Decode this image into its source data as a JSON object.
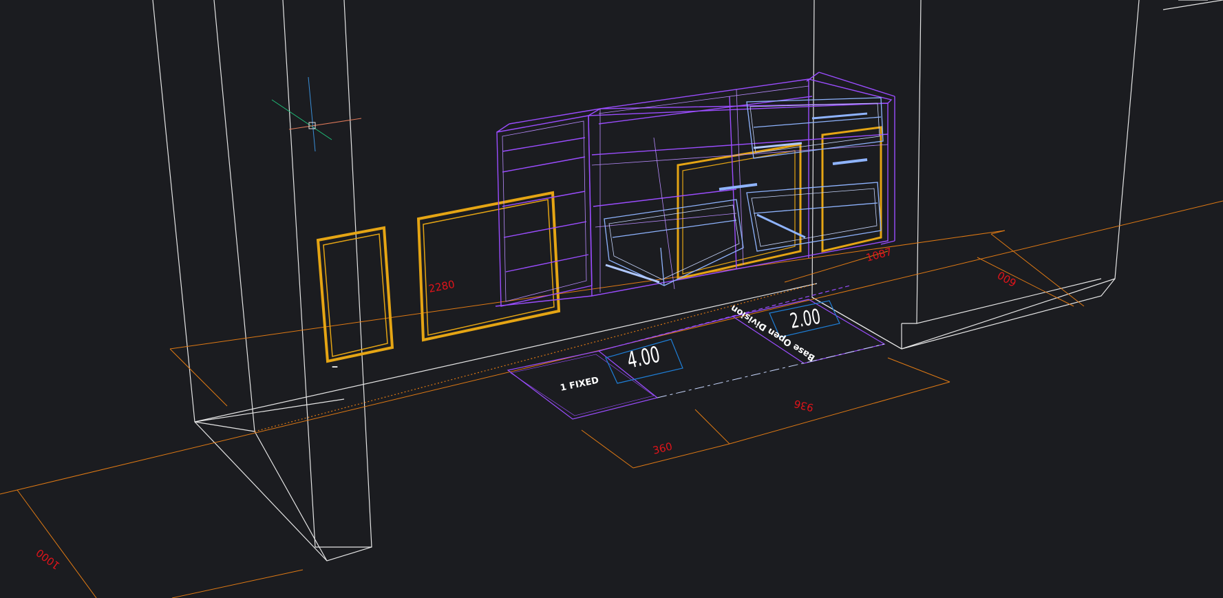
{
  "app": {
    "view": "3D wireframe model viewport"
  },
  "colors": {
    "background": "#1b1c20",
    "wall": "#e6e6e6",
    "cabinet": "#9b4dff",
    "cabinet_light": "#b98cff",
    "drawer": "#8fb4ff",
    "door_panel": "#e5a514",
    "dimension_line": "#e07a14",
    "dimension_text": "#e0141a",
    "tag_box": "#1e7fd8",
    "ucs_x": "#e07a5a",
    "ucs_y": "#1fc07a",
    "ucs_z": "#3a8fd8"
  },
  "dimensions": {
    "width_2280": "2280",
    "depth_600": "600",
    "height_1000": "1000",
    "segment_360": "360",
    "segment_936": "936",
    "edge_1087": "1087"
  },
  "tags": {
    "left_multiplier": "4.00",
    "right_multiplier": "2.00",
    "fixed_label": "1 FIXED",
    "division_label": "Base Open Division",
    "small_mark": "‒"
  },
  "icons": {
    "ucs": "ucs-crosshair-icon"
  }
}
